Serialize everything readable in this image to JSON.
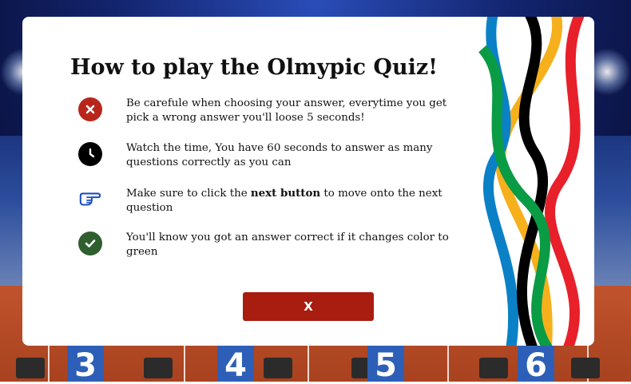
{
  "modal": {
    "title": "How to play the Olmypic Quiz!",
    "rules": [
      {
        "icon": "x-circle-icon",
        "color": "#b8261a",
        "text": "Be carefule when choosing your answer, everytime you get pick a wrong answer you'll loose 5 seconds!"
      },
      {
        "icon": "clock-icon",
        "color": "#000000",
        "text": "Watch the time, You have 60 seconds to answer as many questions correctly as you can"
      },
      {
        "icon": "pointing-hand-icon",
        "color": "#1f4fbf",
        "text_before": "Make sure to click the ",
        "text_bold": "next button",
        "text_after": " to move onto the next question"
      },
      {
        "icon": "check-circle-icon",
        "color": "#2f5e2f",
        "text": "You'll know you got an answer correct if it changes color to green"
      }
    ],
    "close_label": "X"
  },
  "background": {
    "lane_numbers": [
      "3",
      "4",
      "5",
      "6"
    ]
  },
  "colors": {
    "close_button": "#a91c10",
    "ring_blue": "#0a81c6",
    "ring_black": "#000000",
    "ring_red": "#e8202a",
    "ring_yellow": "#f6b01b",
    "ring_green": "#0a9b45"
  }
}
